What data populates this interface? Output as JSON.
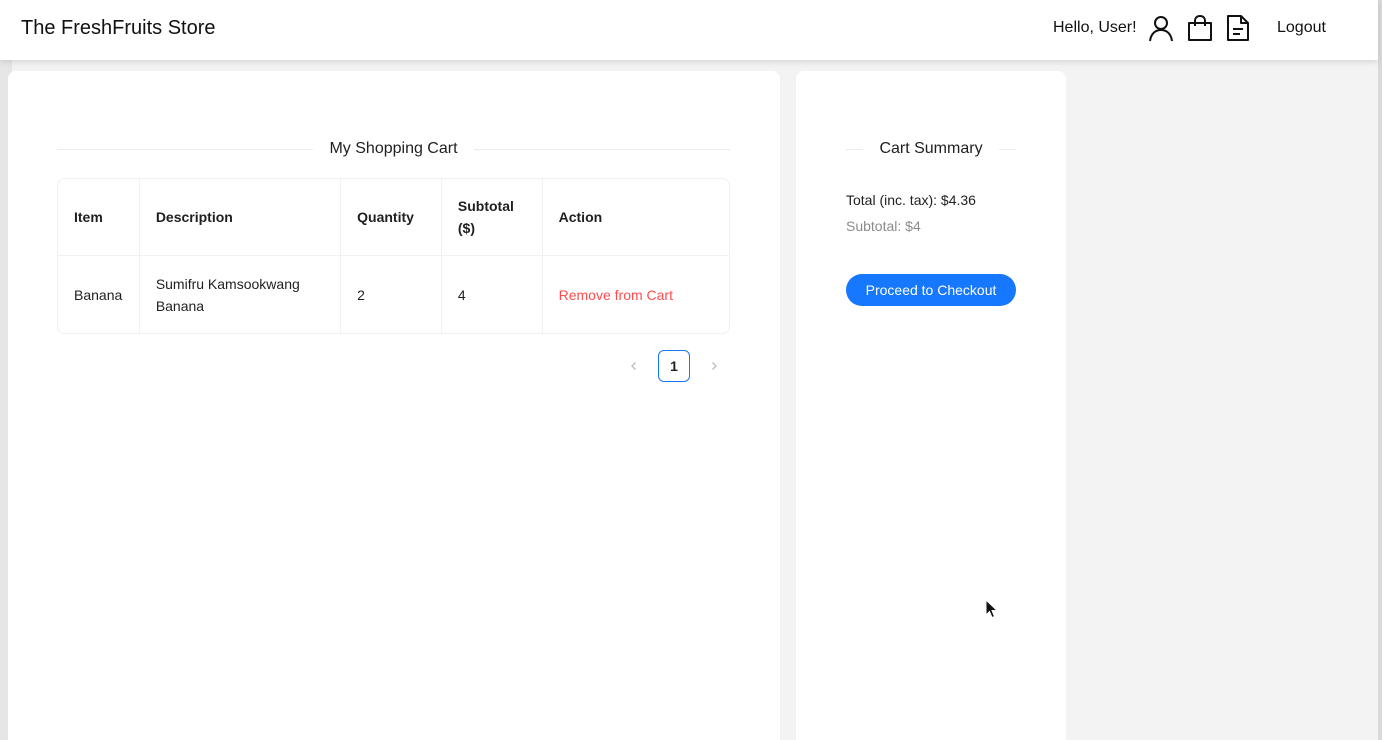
{
  "header": {
    "brand": "The FreshFruits Store",
    "greeting": "Hello, User!",
    "icons": [
      "user-icon",
      "shopping-bag-icon",
      "orders-document-icon"
    ],
    "logout_label": "Logout"
  },
  "cart": {
    "title": "My Shopping Cart",
    "columns": [
      "Item",
      "Description",
      "Quantity",
      "Subtotal\n($)",
      "Action"
    ],
    "rows": [
      {
        "item": "Banana",
        "description": "Sumifru Kamsookwang Banana",
        "quantity": "2",
        "subtotal": "4",
        "action": "Remove from Cart"
      }
    ],
    "pagination": {
      "current_page": "1",
      "prev_icon": "chevron-left-icon",
      "next_icon": "chevron-right-icon"
    }
  },
  "summary": {
    "title": "Cart Summary",
    "total": "Total (inc. tax): $4.36",
    "subtotal": "Subtotal: $4",
    "checkout_label": "Proceed to Checkout"
  },
  "colors": {
    "primary": "#1677ff",
    "danger": "#ff4d4f",
    "page_background": "#f3f3f3",
    "card_background": "#ffffff"
  }
}
